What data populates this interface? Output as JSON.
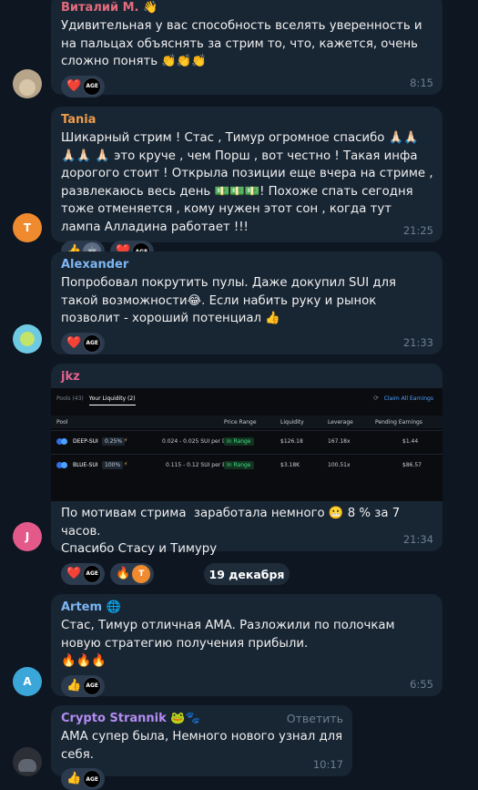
{
  "messages": [
    {
      "author": "Виталий М.",
      "author_badge": "👋",
      "author_color": "#e36b7b",
      "text": "Удивительная у вас способность вселять уверенность и на пальцах объяснять за стрим то, что, кажется, очень сложно понять 👏👏👏",
      "reactions": [
        {
          "emoji": "❤️",
          "avatar": "AGE"
        }
      ],
      "time": "8:15"
    },
    {
      "author": "Tania",
      "author_color": "#ee9c4c",
      "avatar_letter": "T",
      "avatar_color": "#f08a2e",
      "text": "Шикарный стрим ! Стас , Тимур огромное спасибо 🙏🏻🙏🏻🙏🏻🙏🏻 🙏🏻 это круче , чем Порш , вот честно ! Такая инфа дорогого стоит ! Открыла позиции еще вчера на стриме , развлекаюсь весь день 💵💵💵! Похоже спать сегодня тоже отменяется , кому нужен этот сон , когда тут лампа Алладина работает !!!",
      "reactions": [
        {
          "emoji": "👍",
          "avatar": "🤖"
        },
        {
          "emoji": "❤️",
          "avatar": "AGE"
        }
      ],
      "time": "21:25"
    },
    {
      "author": "Alexander",
      "author_color": "#7eb6f2",
      "text": "Попробовал покрутить пулы. Даже докупил SUI для такой возможности😂. Если набить руку и рынок позволит - хороший потенциал 👍",
      "reactions": [
        {
          "emoji": "❤️",
          "avatar": "AGE"
        }
      ],
      "time": "21:33"
    },
    {
      "author": "jkz",
      "author_color": "#e3628e",
      "avatar_letter": "J",
      "avatar_color": "#e35a8a",
      "embedded_screenshot": {
        "tabs": [
          "Pools (43)",
          "Your Liquidity (2)"
        ],
        "claim": "Claim All Earnings",
        "headers": [
          "Pool",
          "Price Range",
          "Liquidity",
          "Leverage",
          "Pending Earnings"
        ],
        "rows": [
          {
            "pool": "DEEP-SUI",
            "fee": "0.25%",
            "range": "0.024 - 0.025 SUI per DEEP",
            "status": "In Range",
            "liquidity": "$126.18",
            "leverage": "167.18x",
            "earnings": "$1.44"
          },
          {
            "pool": "BLUE-SUI",
            "fee": "100%",
            "range": "0.115 - 0.12 SUI per BLUE",
            "status": "In Range",
            "liquidity": "$3.18K",
            "leverage": "100.51x",
            "earnings": "$86.57"
          }
        ]
      },
      "text": "По мотивам стрима  заработала немного 😬 8 % за 7 часов.\nСпасибо Стасу и Тимуру",
      "reactions": [
        {
          "emoji": "❤️",
          "avatar": "AGE"
        },
        {
          "emoji": "🔥",
          "avatar": "T"
        }
      ],
      "time": "21:34"
    },
    {
      "author": "Artem",
      "author_badge": "🌐",
      "author_color": "#7eb6f2",
      "avatar_letter": "A",
      "avatar_color": "#3ba6d8",
      "text": "Стас, Тимур отличная AMA. Разложили по полочкам новую стратегию получения прибыли.\n🔥🔥🔥",
      "reactions": [
        {
          "emoji": "👍",
          "avatar": "AGE"
        }
      ],
      "time": "6:55"
    },
    {
      "author": "Crypto Strannik",
      "author_badge": "🐸🐾",
      "author_color": "#b48cf2",
      "reply_label": "Ответить",
      "text": "АМА супер была, Немного нового узнал для себя.",
      "reactions": [
        {
          "emoji": "👍",
          "avatar": "AGE"
        }
      ],
      "time": "10:17"
    }
  ],
  "date_separator": "19 декабря"
}
